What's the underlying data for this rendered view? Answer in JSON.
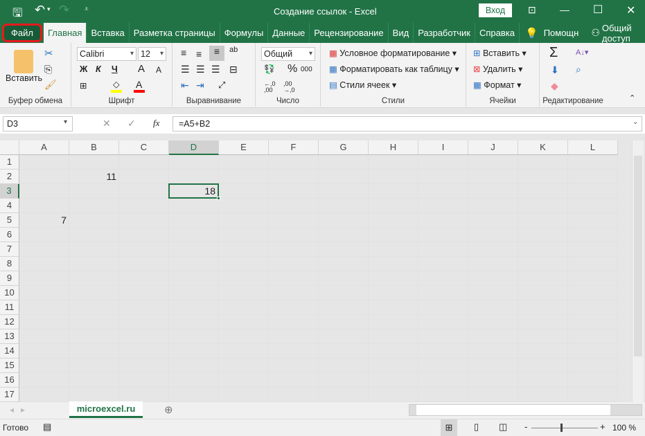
{
  "title": "Создание ссылок  -  Excel",
  "qat": {
    "save": "save-icon",
    "undo": "undo-icon",
    "redo": "redo-icon",
    "customize": "customize-icon"
  },
  "window": {
    "signin": "Вход",
    "min": "—",
    "max": "☐",
    "close": "✕"
  },
  "tabs": [
    "Файл",
    "Главная",
    "Вставка",
    "Разметка страницы",
    "Формулы",
    "Данные",
    "Рецензирование",
    "Вид",
    "Разработчик",
    "Справка"
  ],
  "tell_me": "Помощн",
  "share": "Общий доступ",
  "ribbon": {
    "clipboard": {
      "label": "Буфер обмена",
      "paste": "Вставить"
    },
    "font": {
      "label": "Шрифт",
      "name": "Calibri",
      "size": "12",
      "bold": "Ж",
      "italic": "К",
      "underline": "Ч",
      "grow": "A",
      "shrink": "A",
      "color_letter": "A",
      "fill_color": "#ffff00",
      "font_color": "#ff0000"
    },
    "alignment": {
      "label": "Выравнивание",
      "wrap": "ab"
    },
    "number": {
      "label": "Число",
      "format": "Общий",
      "percent": "%",
      "thousands": "000",
      "inc": "←,0 ,00",
      "dec": ",00 →,0"
    },
    "styles": {
      "label": "Стили",
      "conditional": "Условное форматирование",
      "as_table": "Форматировать как таблицу",
      "cell_styles": "Стили ячеек"
    },
    "cells": {
      "label": "Ячейки",
      "insert": "Вставить",
      "delete": "Удалить",
      "format": "Формат"
    },
    "editing": {
      "label": "Редактирование",
      "sum": "Σ"
    }
  },
  "formula_bar": {
    "name_box": "D3",
    "formula": "=A5+B2",
    "fx": "fx"
  },
  "grid": {
    "columns": [
      "A",
      "B",
      "C",
      "D",
      "E",
      "F",
      "G",
      "H",
      "I",
      "J",
      "K",
      "L"
    ],
    "rows": [
      "1",
      "2",
      "3",
      "4",
      "5",
      "6",
      "7",
      "8",
      "9",
      "10",
      "11",
      "12",
      "13",
      "14",
      "15",
      "16",
      "17"
    ],
    "selected": "D3",
    "cells": [
      {
        "ref": "B2",
        "value": "11"
      },
      {
        "ref": "D3",
        "value": "18"
      },
      {
        "ref": "A5",
        "value": "7"
      }
    ]
  },
  "sheet_tabs": [
    "microexcel.ru"
  ],
  "status": {
    "ready": "Готово",
    "zoom": "100 %",
    "zoom_level": 100
  },
  "accent": "#217346"
}
